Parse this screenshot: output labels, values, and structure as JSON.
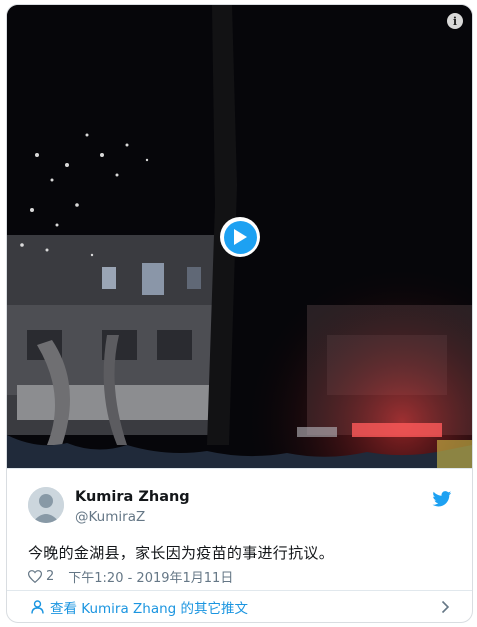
{
  "media": {
    "info_icon": "info-icon",
    "info_glyph": "i",
    "play_icon": "play-icon",
    "accent": "#1da1f2"
  },
  "tweet": {
    "author_name": "Kumira Zhang",
    "author_handle": "@KumiraZ",
    "text": "今晚的金湖县，家长因为疫苗的事进行抗议。",
    "like_count": "2",
    "timestamp": "下午1:20 - 2019年1月11日",
    "brand_icon": "twitter-bird-icon"
  },
  "footer": {
    "link_text": "查看 Kumira Zhang 的其它推文",
    "link_color": "#1b95e0"
  }
}
